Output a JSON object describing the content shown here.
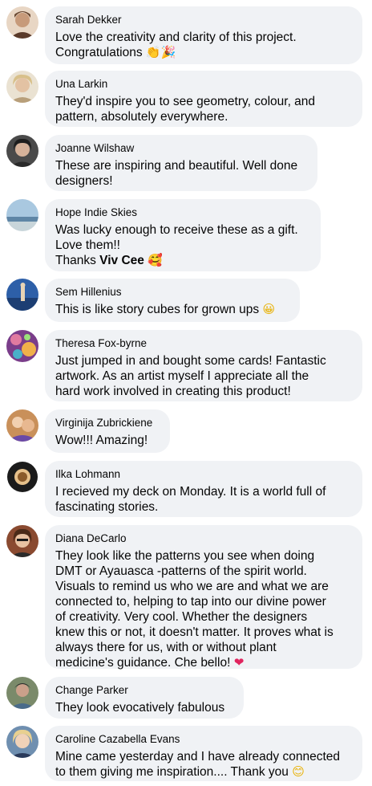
{
  "comments": [
    {
      "name": "Sarah Dekker",
      "line1": "Love the creativity and clarity of this project.",
      "line2": "Congratulations",
      "emoji1": "👏",
      "emoji2": "🎉",
      "emoji1_name": "clapping-hands",
      "emoji2_name": "party-popper",
      "avatar_color": "#c79a7a"
    },
    {
      "name": "Una Larkin",
      "line1": "They'd inspire you to see geometry, colour, and",
      "line2": "pattern, absolutely everywhere.",
      "avatar_color": "#d9c7a8"
    },
    {
      "name": "Joanne Wilshaw",
      "line1": "These are inspiring and beautiful. Well done",
      "line2": "designers!",
      "avatar_color": "#3b3b3b"
    },
    {
      "name": "Hope Indie Skies",
      "line1": "Was lucky enough to receive these as a gift.",
      "line2": "Love them!!",
      "line3_prefix": "Thanks",
      "mention": "Viv Cee",
      "emoji1": "🥰",
      "emoji1_name": "smiling-face-with-hearts",
      "avatar_color": "#8fb3d1"
    },
    {
      "name": "Sem Hillenius",
      "line1": "This is like story cubes for grown ups",
      "emoji1": "😀",
      "emoji1_name": "grinning-face",
      "avatar_color": "#2d5fa8"
    },
    {
      "name": "Theresa Fox-byrne",
      "line1": "Just jumped in and bought some cards! Fantastic",
      "line2": "artwork. As an artist myself I appreciate all the",
      "line3": "hard work involved in creating this product!",
      "avatar_color": "#b7488a"
    },
    {
      "name": "Virginija Zubrickiene",
      "line1": "Wow!!! Amazing!",
      "avatar_color": "#c9905a"
    },
    {
      "name": "Ilka Lohmann",
      "line1": "I recieved my deck on Monday. It is a world full of",
      "line2": "fascinating stories.",
      "avatar_color": "#1b1b1b"
    },
    {
      "name": "Diana DeCarlo",
      "lines": [
        "They look like the patterns you see when doing",
        "DMT or Ayauasca -patterns of the spirit world.",
        "Visuals to remind us who we are and what we are",
        "connected to, helping to tap into our divine power",
        "of creativity. Very cool. Whether the designers",
        "knew this or not, it doesn't matter. It proves what is",
        "always there for us, with or without plant",
        "medicine's guidance. Che bello!"
      ],
      "emoji1": "❤",
      "emoji1_name": "red-heart",
      "avatar_color": "#a05a3c"
    },
    {
      "name": "Change Parker",
      "line1": "They look evocatively fabulous",
      "avatar_color": "#4a6b8a"
    },
    {
      "name": "Caroline Cazabella Evans",
      "line1": "Mine came yesterday and I have already connected",
      "line2": "to them giving me inspiration.... Thank you",
      "emoji1": "😊",
      "emoji1_name": "smiling-face",
      "avatar_color": "#6f8fb0"
    }
  ]
}
